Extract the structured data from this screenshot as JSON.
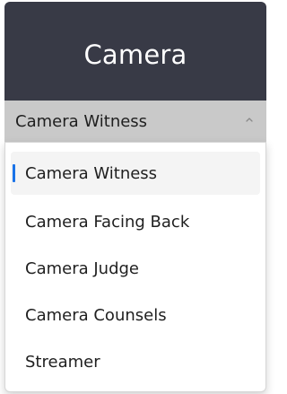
{
  "header": {
    "title": "Camera"
  },
  "select": {
    "value": "Camera Witness",
    "icon": "chevron-up-icon"
  },
  "dropdown": {
    "selected_index": 0,
    "options": [
      {
        "label": "Camera Witness"
      },
      {
        "label": "Camera Facing Back"
      },
      {
        "label": "Camera Judge"
      },
      {
        "label": "Camera Counsels"
      },
      {
        "label": "Streamer"
      }
    ]
  },
  "colors": {
    "header_bg": "#383a46",
    "select_bg": "#c9c9c9",
    "selected_marker": "#1a73e8"
  }
}
